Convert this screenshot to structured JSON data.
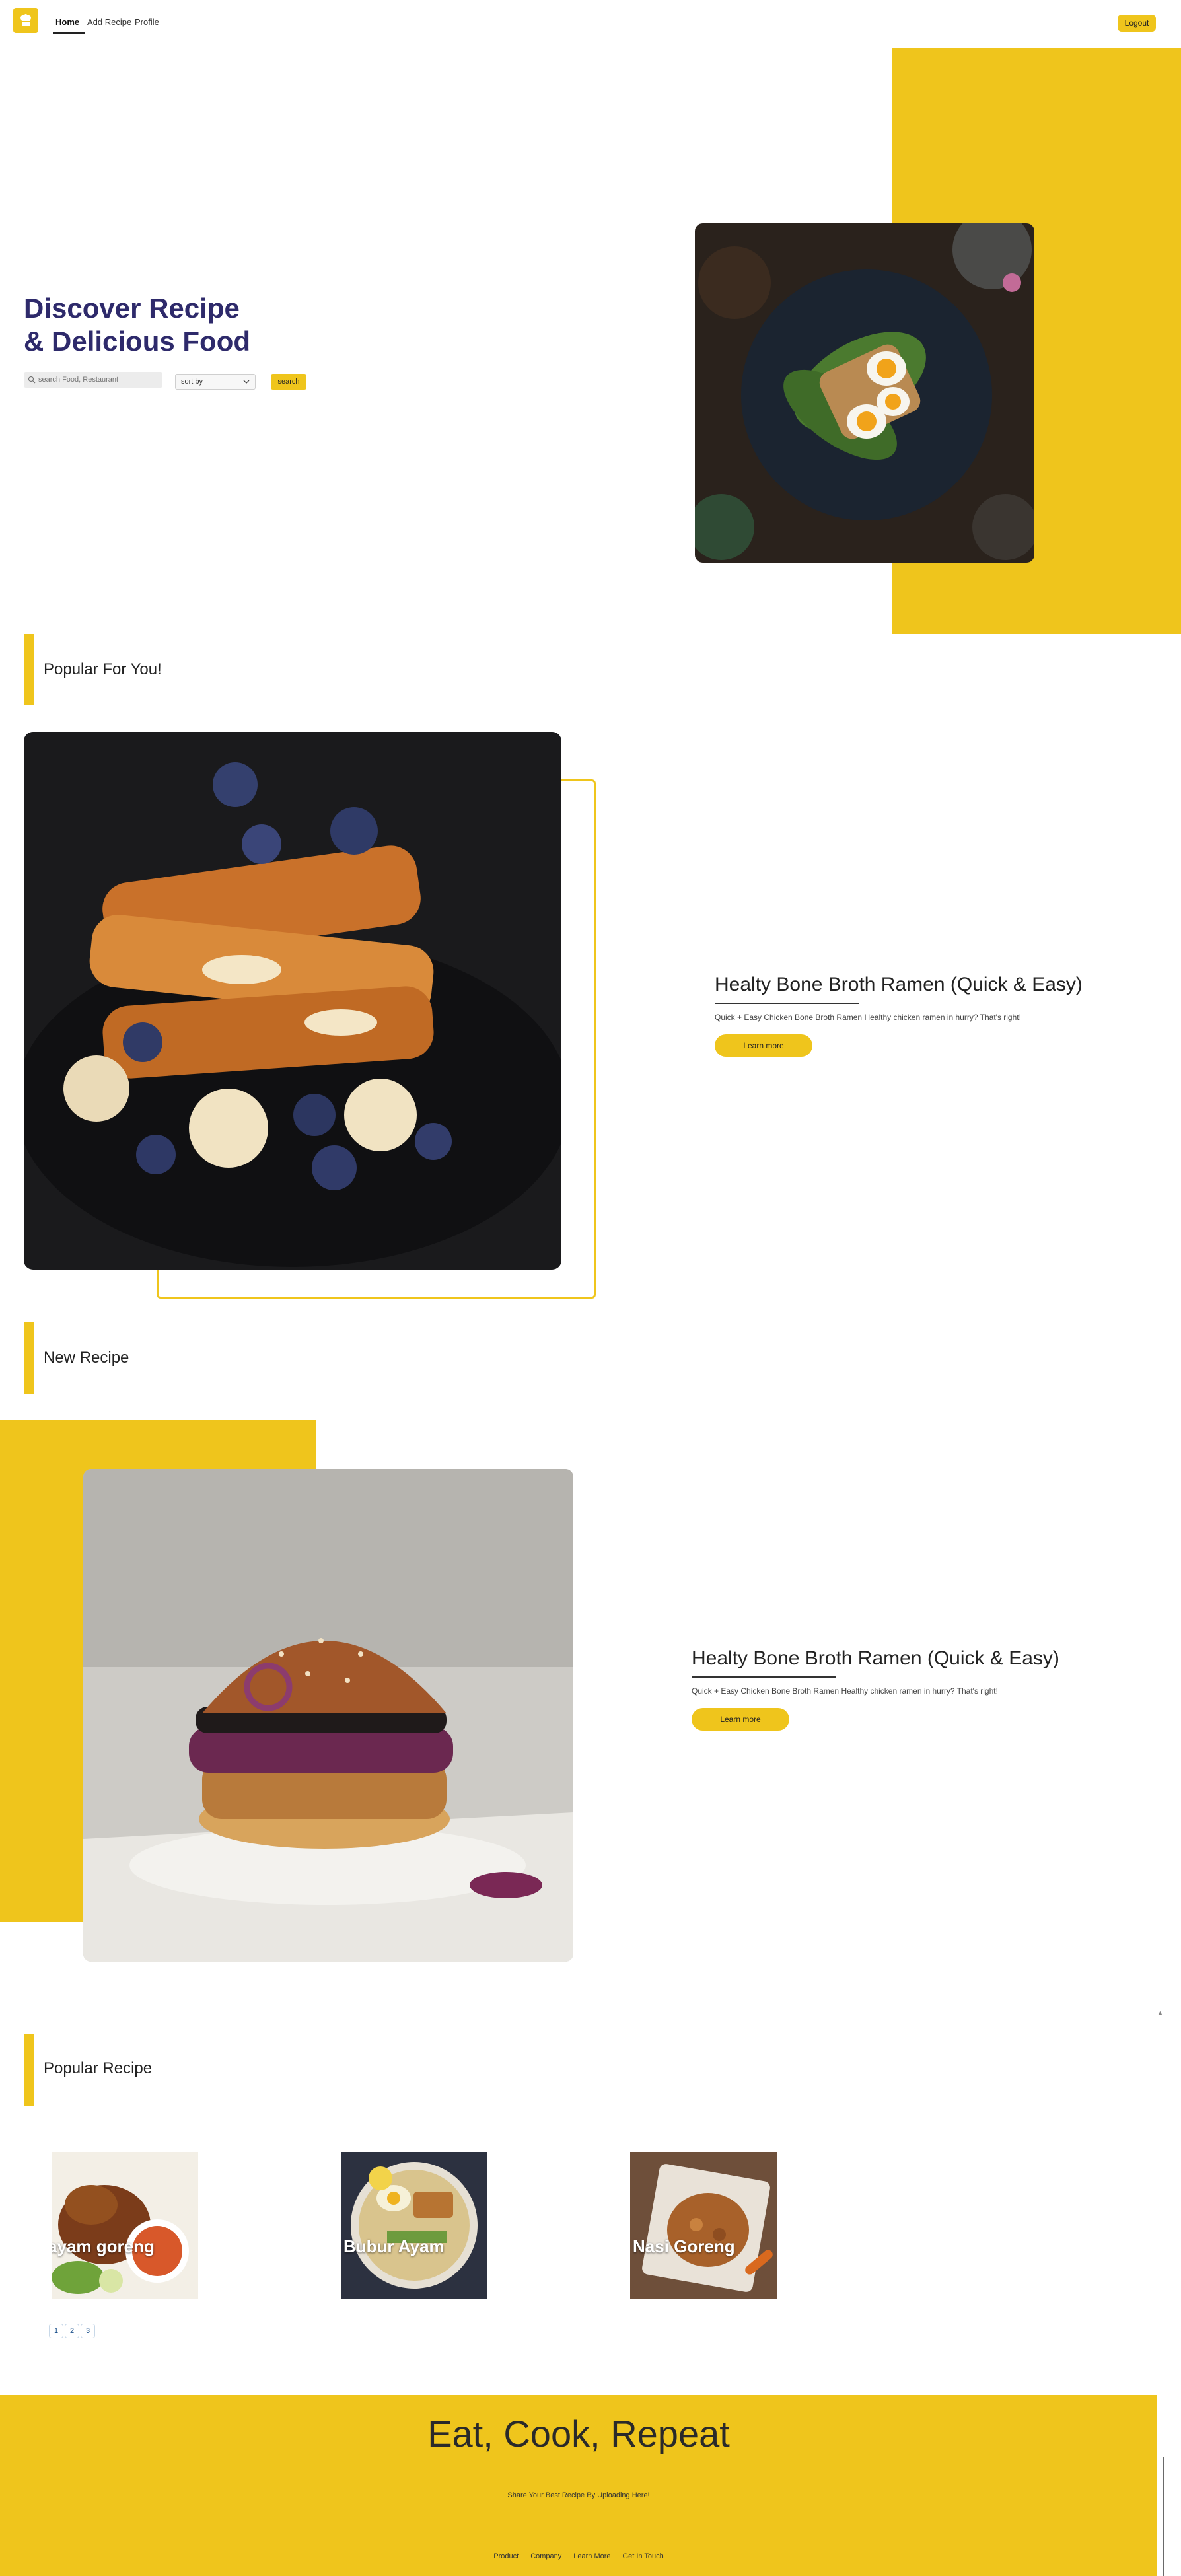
{
  "header": {
    "nav": [
      "Home",
      "Add Recipe",
      "Profile"
    ],
    "logout_label": "Logout"
  },
  "hero": {
    "title_line1": "Discover Recipe",
    "title_line2": "& Delicious Food",
    "search_placeholder": "search Food, Restaurant",
    "sort_label": "sort by",
    "search_button": "search"
  },
  "popular_for_you": {
    "heading": "Popular For You!",
    "title": "Healty Bone Broth Ramen (Quick & Easy)",
    "description": "Quick + Easy Chicken Bone Broth Ramen Healthy chicken ramen in hurry? That's right!",
    "button": "Learn more"
  },
  "new_recipe": {
    "heading": "New Recipe",
    "title": "Healty Bone Broth Ramen (Quick & Easy)",
    "description": "Quick + Easy Chicken Bone Broth Ramen Healthy chicken ramen in hurry? That's right!",
    "button": "Learn more"
  },
  "popular_recipe": {
    "heading": "Popular Recipe",
    "items": [
      "ayam goreng",
      "Bubur Ayam",
      "Nasi Goreng"
    ],
    "pages": [
      "1",
      "2",
      "3"
    ]
  },
  "footer": {
    "title": "Eat, Cook, Repeat",
    "subtitle": "Share Your Best Recipe By Uploading Here!",
    "links": [
      "Product",
      "Company",
      "Learn More",
      "Get In Touch"
    ]
  },
  "colors": {
    "accent": "#efc51c",
    "title": "#2e2a6b"
  }
}
